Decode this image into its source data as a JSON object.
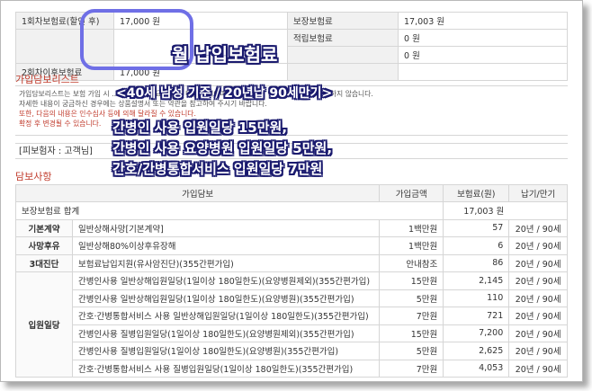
{
  "top_left_rows": [
    {
      "label": "1회차보험료(할인 후)",
      "value": "17,000 원"
    },
    {
      "label": "2회차이후보험료",
      "value": "17,000 원"
    }
  ],
  "top_right_rows": [
    {
      "label": "보장보험료",
      "value": "17,003 원"
    },
    {
      "label": "적립보험료",
      "value": "0 원"
    },
    {
      "label": "",
      "value": "0 원"
    }
  ],
  "sections": {
    "guarantee_list": "가입담보리스트",
    "coverage": "담보사항"
  },
  "notice_lines": [
    "가입담보리스트는 보험 가입 시 ... 보상하는 주요 보장에 대한 예시이며, 일부 내용은 약관을 기준으로 표시하지 않습니다.",
    "자세한 내용이 궁금하신 경우에는 상품설명서 또는 약관을 참고하여 주시기 바랍니다.",
    "또한, 다음의 내용은 인수심사 등에 의해 달라질 수 있습니다.",
    "확정 후 변경될 수 있습니다."
  ],
  "holder": "[피보험자 : 고객님]",
  "table": {
    "headers": [
      "가입담보",
      "가입금액",
      "보험료(원)",
      "납기/만기"
    ],
    "total_label": "보장보험료 합계",
    "total_value": "17,003 원",
    "rows": [
      {
        "category": "기본계약",
        "name": "일반상해사망[기본계약]",
        "amount": "1백만원",
        "premium": "57",
        "term": "20년 / 90세"
      },
      {
        "category": "사망후유",
        "name": "일반상해80%이상후유장해",
        "amount": "1백만원",
        "premium": "6",
        "term": "20년 / 90세"
      },
      {
        "category": "3대진단",
        "name": "보험료납입지원(유사암진단)(355간편가입)",
        "amount": "안내참조",
        "premium": "86",
        "term": "20년 / 90세"
      },
      {
        "category": "",
        "name": "간병인사용 일반상해입원일당(1일이상 180일한도)(요양병원제외)(355간편가입)",
        "amount": "15만원",
        "premium": "2,145",
        "term": "20년 / 90세"
      },
      {
        "category": "",
        "name": "간병인사용 일반상해입원일당(1일이상 180일한도)(요양병원)(355간편가입)",
        "amount": "5만원",
        "premium": "110",
        "term": "20년 / 90세"
      },
      {
        "category": "입원일당",
        "name": "간호·간병통합서비스 사용 일반상해입원일당(1일이상 180일한도)(355간편가입)",
        "amount": "7만원",
        "premium": "721",
        "term": "20년 / 90세"
      },
      {
        "category": "",
        "name": "간병인사용 질병입원일당(1일이상 180일한도)(요양병원제외)(355간편가입)",
        "amount": "15만원",
        "premium": "7,200",
        "term": "20년 / 90세"
      },
      {
        "category": "",
        "name": "간병인사용 질병입원일당(1일이상 180일한도)(요양병원)(355간편가입)",
        "amount": "5만원",
        "premium": "2,625",
        "term": "20년 / 90세"
      },
      {
        "category": "",
        "name": "간호·간병통합서비스 사용 질병입원일당(1일이상 180일한도)(355간편가입)",
        "amount": "7만원",
        "premium": "4,053",
        "term": "20년 / 90세"
      }
    ]
  },
  "overlay": {
    "title": "월 납입보험료",
    "condition": "<40세 남성 기준 / 20년납 90세만기>",
    "lines": [
      "간병인 사용 입원일당 15만원,",
      "간병인 사용 요양병원 입원일당 5만원,",
      "간호/간병통합서비스 입원일당 7만원"
    ]
  },
  "colors": {
    "section_red": "#c03a2b",
    "circle": "#6f6fe6",
    "overlay_outline": "#1a1a6e"
  }
}
